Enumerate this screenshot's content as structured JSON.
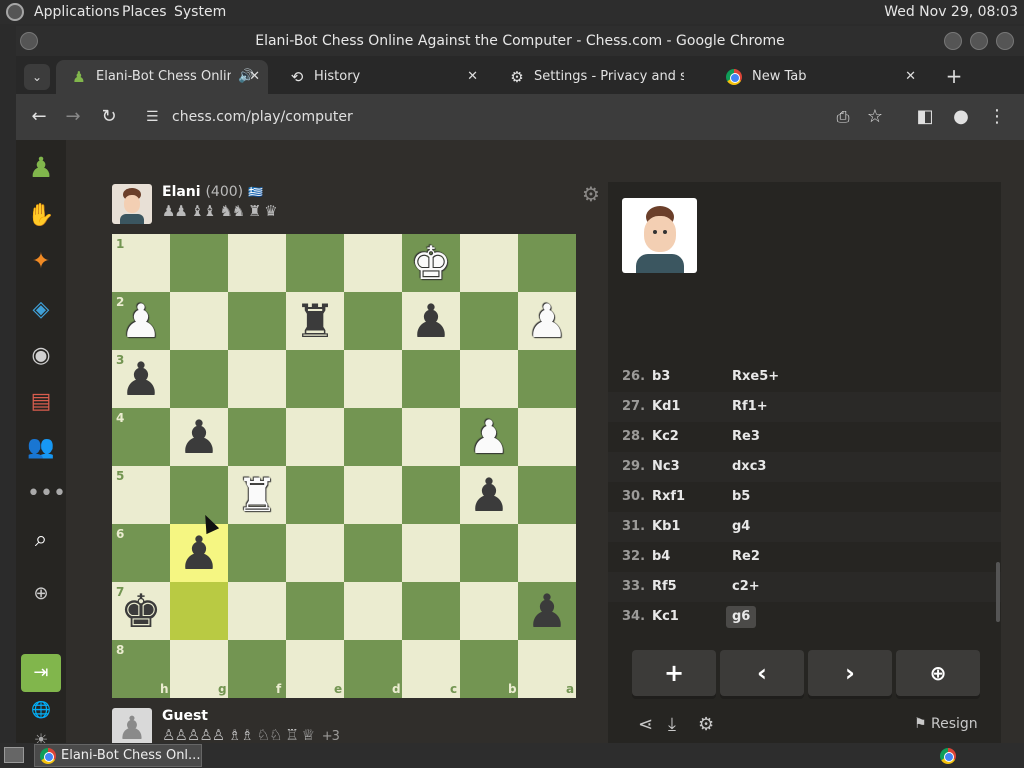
{
  "os_panel": {
    "menus": [
      "Applications",
      "Places",
      "System"
    ],
    "clock": "Wed Nov 29, 08:03"
  },
  "window": {
    "title": "Elani-Bot Chess Online Against the Computer - Chess.com - Google Chrome"
  },
  "tabs": [
    {
      "label": "Elani-Bot Chess Online",
      "icon": "pawn-icon",
      "active": true
    },
    {
      "label": "History",
      "icon": "history-icon",
      "active": false
    },
    {
      "label": "Settings - Privacy and security",
      "icon": "gear-icon",
      "active": false
    },
    {
      "label": "New Tab",
      "icon": "chrome-icon",
      "active": false
    }
  ],
  "toolbar": {
    "url": "chess.com/play/computer"
  },
  "players": {
    "top": {
      "name": "Elani",
      "rating": "(400)",
      "flag": "🇬🇷",
      "captured": "♟♟ ♝♝ ♞♞ ♜ ♛"
    },
    "bottom": {
      "name": "Guest",
      "captured": "♙♙♙♙♙ ♗♗ ♘♘ ♖ ♕",
      "advantage": "+3"
    }
  },
  "board": {
    "ranks": [
      "1",
      "2",
      "3",
      "4",
      "5",
      "6",
      "7",
      "8"
    ],
    "files": [
      "h",
      "g",
      "f",
      "e",
      "d",
      "c",
      "b",
      "a"
    ],
    "highlight": [
      {
        "row": 5,
        "col": 1
      },
      {
        "row": 6,
        "col": 1
      }
    ],
    "pieces": [
      {
        "row": 0,
        "col": 5,
        "glyph": "♚",
        "color": "w"
      },
      {
        "row": 1,
        "col": 0,
        "glyph": "♟",
        "color": "w"
      },
      {
        "row": 1,
        "col": 3,
        "glyph": "♜",
        "color": "b"
      },
      {
        "row": 1,
        "col": 5,
        "glyph": "♟",
        "color": "b"
      },
      {
        "row": 1,
        "col": 7,
        "glyph": "♟",
        "color": "w"
      },
      {
        "row": 2,
        "col": 0,
        "glyph": "♟",
        "color": "b"
      },
      {
        "row": 3,
        "col": 1,
        "glyph": "♟",
        "color": "b"
      },
      {
        "row": 3,
        "col": 6,
        "glyph": "♟",
        "color": "w"
      },
      {
        "row": 4,
        "col": 2,
        "glyph": "♜",
        "color": "w"
      },
      {
        "row": 4,
        "col": 6,
        "glyph": "♟",
        "color": "b"
      },
      {
        "row": 5,
        "col": 1,
        "glyph": "♟",
        "color": "b"
      },
      {
        "row": 6,
        "col": 0,
        "glyph": "♚",
        "color": "b"
      },
      {
        "row": 6,
        "col": 7,
        "glyph": "♟",
        "color": "b"
      }
    ]
  },
  "moves": [
    {
      "num": "26.",
      "white": "b3",
      "black": "Rxe5+"
    },
    {
      "num": "27.",
      "white": "Kd1",
      "black": "Rf1+"
    },
    {
      "num": "28.",
      "white": "Kc2",
      "black": "Re3"
    },
    {
      "num": "29.",
      "white": "Nc3",
      "black": "dxc3"
    },
    {
      "num": "30.",
      "white": "Rxf1",
      "black": "b5"
    },
    {
      "num": "31.",
      "white": "Kb1",
      "black": "g4"
    },
    {
      "num": "32.",
      "white": "b4",
      "black": "Re2"
    },
    {
      "num": "33.",
      "white": "Rf5",
      "black": "c2+"
    },
    {
      "num": "34.",
      "white": "Kc1",
      "black": "g6"
    }
  ],
  "controls": {
    "resign_label": "Resign"
  },
  "taskbar": {
    "item": "Elani-Bot Chess Onl..."
  },
  "colors": {
    "board_light": "#ebecd0",
    "board_dark": "#739552",
    "accent_green": "#81b64c"
  }
}
